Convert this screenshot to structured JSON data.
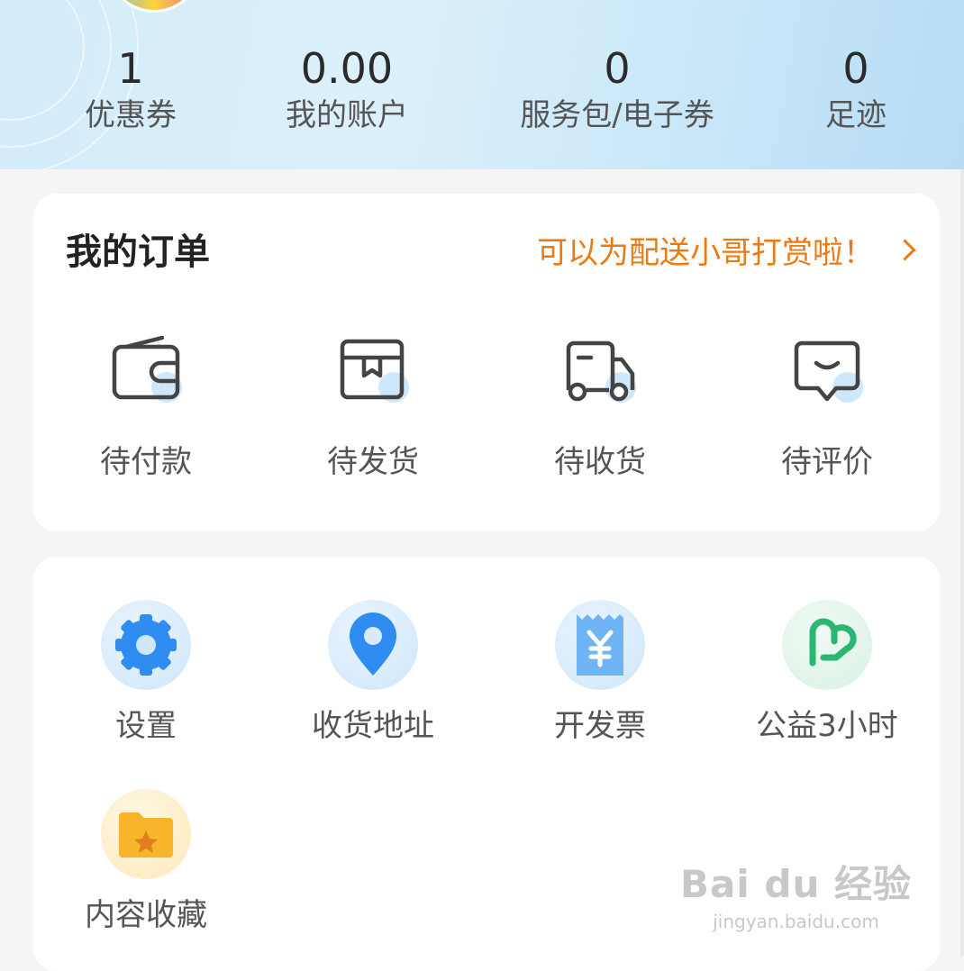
{
  "stats": [
    {
      "value": "1",
      "label": "优惠券"
    },
    {
      "value": "0.00",
      "label": "我的账户"
    },
    {
      "value": "0",
      "label": "服务包/电子券"
    },
    {
      "value": "0",
      "label": "足迹"
    }
  ],
  "orders": {
    "title": "我的订单",
    "promo_link": "可以为配送小哥打赏啦！",
    "items": [
      {
        "label": "待付款",
        "icon": "wallet-icon"
      },
      {
        "label": "待发货",
        "icon": "package-icon"
      },
      {
        "label": "待收货",
        "icon": "truck-icon"
      },
      {
        "label": "待评价",
        "icon": "comment-icon"
      }
    ]
  },
  "tools": {
    "items": [
      {
        "label": "设置",
        "icon": "gear-icon"
      },
      {
        "label": "收货地址",
        "icon": "location-pin-icon"
      },
      {
        "label": "开发票",
        "icon": "invoice-icon"
      },
      {
        "label": "公益3小时",
        "icon": "heart-icon"
      },
      {
        "label": "内容收藏",
        "icon": "folder-star-icon"
      }
    ]
  },
  "watermark": {
    "brand": "Bai du 经验",
    "url": "jingyan.baidu.com"
  },
  "colors": {
    "accent_orange": "#ec7a12",
    "icon_blue": "#2f8cf0",
    "icon_green": "#2bb673",
    "icon_yellow": "#f7b52c"
  }
}
